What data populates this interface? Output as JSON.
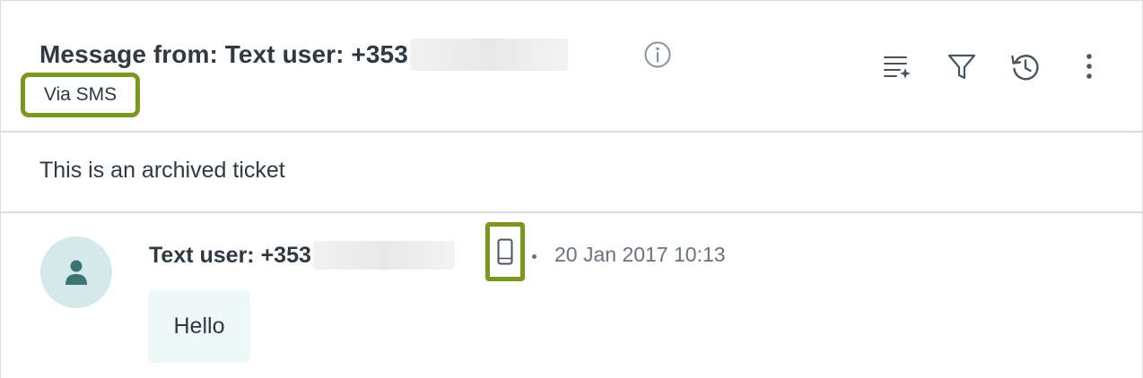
{
  "header": {
    "title": "Message from: Text user: +353",
    "via_label": "Via SMS"
  },
  "icons": {
    "info": "info-icon",
    "summarize": "summarize-sparkle-icon",
    "filter": "filter-icon",
    "history": "history-icon",
    "more": "more-vertical-icon",
    "avatar": "user-icon",
    "device": "mobile-phone-icon"
  },
  "archived_notice": "This is an archived ticket",
  "message": {
    "sender": "Text user: +353",
    "separator": "•",
    "timestamp": "20 Jan 2017 10:13",
    "body": "Hello"
  },
  "colors": {
    "highlight": "#78981f",
    "avatar_bg": "#d6e9ea",
    "avatar_fg": "#3c7474",
    "bubble_bg": "#edf8f8",
    "text": "#2f3941",
    "muted": "#68737d"
  }
}
